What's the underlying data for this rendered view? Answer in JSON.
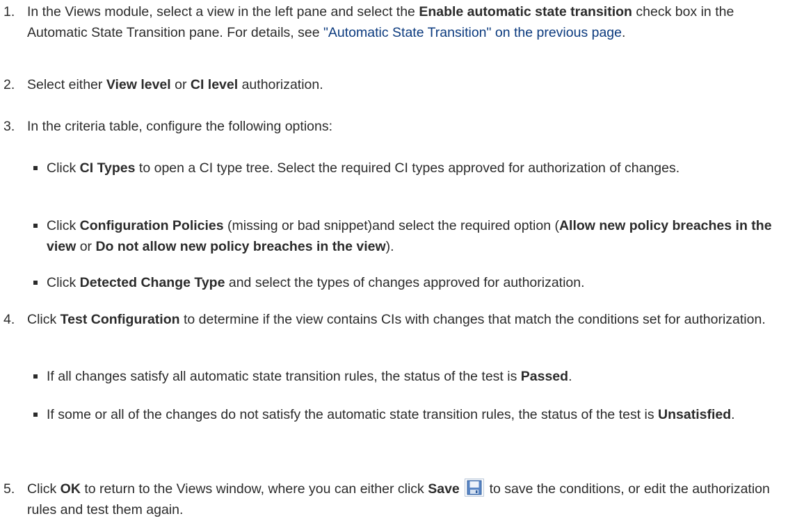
{
  "steps": [
    {
      "number": "1.",
      "parts": [
        {
          "t": "In the Views module, select a view in the left pane and select the "
        },
        {
          "t": "Enable automatic state transition",
          "b": true
        },
        {
          "t": " check box in the Automatic State Transition pane. For details, see "
        },
        {
          "t": "\"Automatic State Transition\" on the previous page",
          "link": true
        },
        {
          "t": "."
        }
      ]
    },
    {
      "number": "2.",
      "parts": [
        {
          "t": "Select either "
        },
        {
          "t": "View level",
          "b": true
        },
        {
          "t": " or "
        },
        {
          "t": "CI level",
          "b": true
        },
        {
          "t": " authorization."
        }
      ]
    },
    {
      "number": "3.",
      "parts": [
        {
          "t": "In the criteria table, configure the following options:"
        }
      ],
      "bullets": [
        [
          {
            "t": "Click "
          },
          {
            "t": "CI Types",
            "b": true
          },
          {
            "t": " to open a CI type tree. Select the required CI types approved for authorization of changes."
          }
        ],
        [
          {
            "t": "Click "
          },
          {
            "t": "Configuration Policies",
            "b": true
          },
          {
            "t": " (missing or bad snippet)and select the required option ("
          },
          {
            "t": "Allow new policy breaches in the view",
            "b": true
          },
          {
            "t": " or "
          },
          {
            "t": "Do not allow new policy breaches in the view",
            "b": true
          },
          {
            "t": ")."
          }
        ],
        [
          {
            "t": "Click "
          },
          {
            "t": "Detected Change Type",
            "b": true
          },
          {
            "t": " and select the types of changes approved for authorization."
          }
        ]
      ]
    },
    {
      "number": "4.",
      "parts": [
        {
          "t": "Click "
        },
        {
          "t": "Test Configuration",
          "b": true
        },
        {
          "t": " to determine if the view contains CIs with changes that match the conditions set for authorization."
        }
      ],
      "bullets": [
        [
          {
            "t": "If all changes satisfy all automatic state transition rules, the status of the test is "
          },
          {
            "t": "Passed",
            "b": true
          },
          {
            "t": "."
          }
        ],
        [
          {
            "t": "If some or all of the changes do not satisfy the automatic state transition rules, the status of the test is "
          },
          {
            "t": "Unsatisfied",
            "b": true
          },
          {
            "t": "."
          }
        ]
      ]
    },
    {
      "number": "5.",
      "parts": [
        {
          "t": "Click "
        },
        {
          "t": "OK",
          "b": true
        },
        {
          "t": " to return to the Views window, where you can either click "
        },
        {
          "t": "Save",
          "b": true
        },
        {
          "t": " "
        },
        {
          "icon": "save-icon"
        },
        {
          "t": " to save the conditions, or edit the authorization rules and test them again."
        }
      ]
    }
  ],
  "colors": {
    "text": "#2b2b2b",
    "link": "#0b3a7e",
    "save_icon": "#5a86c5"
  }
}
